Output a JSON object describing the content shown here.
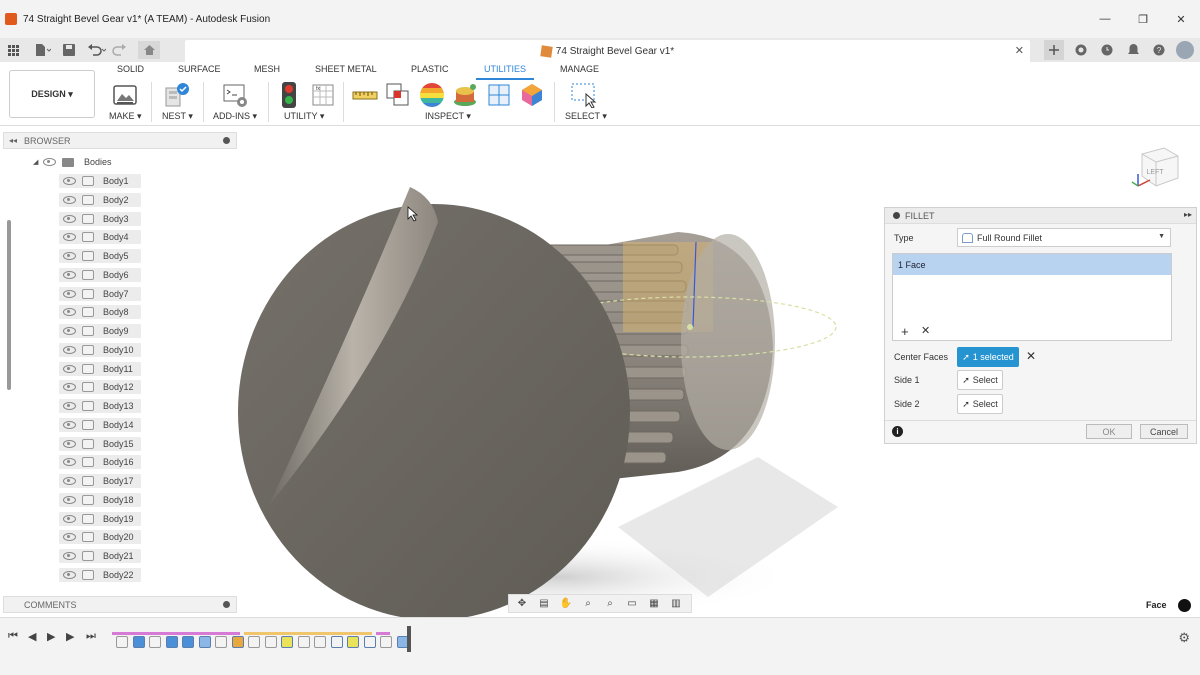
{
  "window": {
    "title": "74 Straight Bevel Gear v1* (A TEAM) - Autodesk Fusion",
    "minimize": "—",
    "maximize": "❐",
    "close": "✕"
  },
  "document_tab": {
    "title": "74 Straight Bevel Gear v1*",
    "close": "✕"
  },
  "quick_access": {
    "icons": [
      "grid-icon",
      "file-icon",
      "save-icon",
      "undo-icon",
      "redo-icon",
      "home-icon"
    ],
    "right_icons": [
      "add-icon",
      "online-icon",
      "clock-icon",
      "bell-icon",
      "help-icon",
      "avatar"
    ]
  },
  "ribbon": {
    "workspace": "DESIGN ▾",
    "tabs": [
      "SOLID",
      "SURFACE",
      "MESH",
      "SHEET METAL",
      "PLASTIC",
      "UTILITIES",
      "MANAGE"
    ],
    "active_tab": "UTILITIES",
    "groups": [
      "MAKE ▾",
      "NEST ▾",
      "ADD-INS ▾",
      "UTILITY ▾",
      "INSPECT ▾",
      "SELECT ▾"
    ],
    "accent_color": "#2e86d8"
  },
  "browser": {
    "title": "BROWSER",
    "root": "Bodies",
    "bodies": [
      "Body1",
      "Body2",
      "Body3",
      "Body4",
      "Body5",
      "Body6",
      "Body7",
      "Body8",
      "Body9",
      "Body10",
      "Body11",
      "Body12",
      "Body13",
      "Body14",
      "Body15",
      "Body16",
      "Body17",
      "Body18",
      "Body19",
      "Body20",
      "Body21",
      "Body22"
    ]
  },
  "comments": {
    "title": "COMMENTS"
  },
  "viewcube": {
    "label": "LEFT"
  },
  "fillet": {
    "title": "FILLET",
    "type_label": "Type",
    "type_value": "Full Round Fillet",
    "faces": [
      "1 Face"
    ],
    "add": "+",
    "remove": "✕",
    "center_faces_label": "Center Faces",
    "center_faces_value": "1 selected",
    "side1_label": "Side 1",
    "side1_value": "Select",
    "side2_label": "Side 2",
    "side2_value": "Select",
    "ok": "OK",
    "cancel": "Cancel",
    "info": "i",
    "active_color": "#2694d0"
  },
  "status": {
    "selection_filter": "Face"
  },
  "timeline": {
    "controls": [
      "⏮",
      "◀",
      "▶",
      "▶",
      "⏭"
    ],
    "settings": "⚙"
  }
}
